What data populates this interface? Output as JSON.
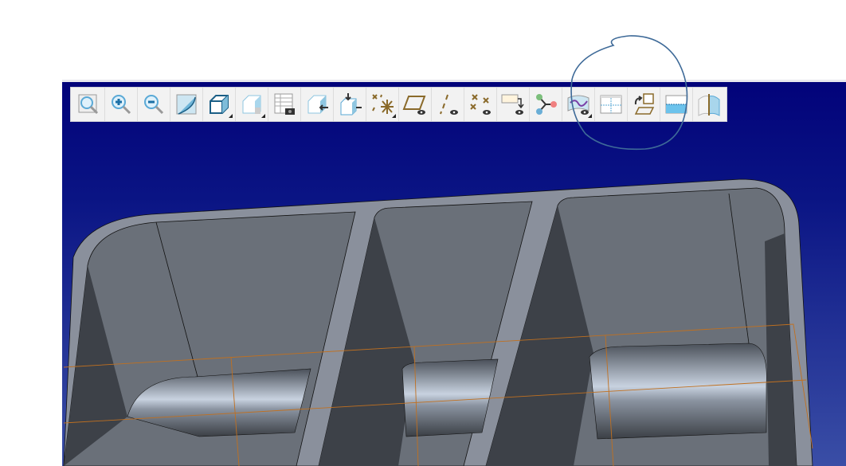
{
  "toolbar": {
    "buttons": [
      {
        "icon": "refit-icon",
        "flyout": false
      },
      {
        "icon": "zoom-in-icon",
        "flyout": false
      },
      {
        "icon": "zoom-out-icon",
        "flyout": false
      },
      {
        "icon": "repaint-icon",
        "flyout": false
      },
      {
        "icon": "display-style-icon",
        "flyout": true
      },
      {
        "icon": "saved-views-icon",
        "flyout": true
      },
      {
        "icon": "view-manager-icon",
        "flyout": false
      },
      {
        "icon": "perspective-view-icon",
        "flyout": false
      },
      {
        "icon": "orient-view-icon",
        "flyout": false
      },
      {
        "icon": "datum-display-filters-icon",
        "flyout": true
      },
      {
        "icon": "plane-display-icon",
        "flyout": false
      },
      {
        "icon": "axis-display-icon",
        "flyout": false
      },
      {
        "icon": "point-display-icon",
        "flyout": false
      },
      {
        "icon": "annotation-display-icon",
        "flyout": false
      },
      {
        "icon": "spin-center-icon",
        "flyout": false
      },
      {
        "icon": "curve-display-icon",
        "flyout": true
      },
      {
        "icon": "section-view-icon",
        "flyout": false
      },
      {
        "icon": "csys-display-icon",
        "flyout": false
      },
      {
        "icon": "cutaway-view-icon",
        "flyout": false
      },
      {
        "icon": "surface-display-icon",
        "flyout": false
      }
    ]
  },
  "colors": {
    "viewport_top": "#02037a",
    "viewport_bottom": "#3a4ea6",
    "part_rim": "#8a909c",
    "part_inner": "#5d6470",
    "annotation": "#3e6a98"
  }
}
